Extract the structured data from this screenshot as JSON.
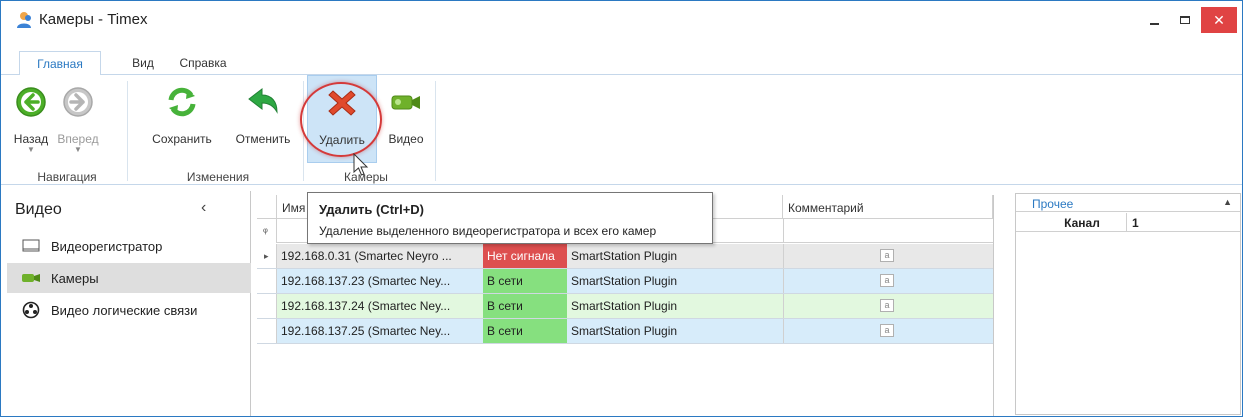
{
  "window": {
    "title": "Камеры - Timex",
    "close_glyph": "✕"
  },
  "tabs": [
    {
      "label": "Главная",
      "active": true
    },
    {
      "label": "Вид",
      "active": false
    },
    {
      "label": "Справка",
      "active": false
    }
  ],
  "ribbon": {
    "groups": [
      {
        "label": "Навигация"
      },
      {
        "label": "Изменения"
      },
      {
        "label": "Камеры"
      }
    ],
    "buttons": {
      "back": {
        "label": "Назад",
        "icon": "back-arrow-icon",
        "color": "#4caf28"
      },
      "forward": {
        "label": "Вперед",
        "icon": "forward-arrow-icon",
        "disabled": true
      },
      "save": {
        "label": "Сохранить",
        "icon": "refresh-icon",
        "color": "#47b23a"
      },
      "cancel": {
        "label": "Отменить",
        "icon": "undo-icon",
        "color": "#2ea843"
      },
      "delete": {
        "label": "Удалить",
        "icon": "delete-x-icon",
        "color": "#e04a2c"
      },
      "video": {
        "label": "Видео",
        "icon": "camera-icon",
        "color": "#6fb12b"
      }
    },
    "dropdown_glyph": "▼"
  },
  "tooltip": {
    "title": "Удалить (Ctrl+D)",
    "description": "Удаление выделенного видеорегистратора и всех его камер"
  },
  "nav": {
    "title": "Видео",
    "collapse_glyph": "‹",
    "items": [
      {
        "label": "Видеорегистратор",
        "icon": "dvr-icon",
        "active": false
      },
      {
        "label": "Камеры",
        "icon": "camera-icon",
        "active": true
      },
      {
        "label": "Видео логические связи",
        "icon": "link-icon",
        "active": false
      }
    ]
  },
  "grid": {
    "columns": [
      {
        "label": "Имя"
      },
      {
        "label": "Комментарий"
      }
    ],
    "filter_glyph": "ᵩ",
    "current_row_glyph": "▸",
    "comment_glyph": "a",
    "rows": [
      {
        "name": "192.168.0.31 (Smartec Neyro ...",
        "status": "Нет сигнала",
        "source": "SmartStation Plugin",
        "status_kind": "offline",
        "bg": "#e8e8e8"
      },
      {
        "name": "192.168.137.23 (Smartec Ney...",
        "status": "В сети",
        "source": "SmartStation Plugin",
        "status_kind": "online",
        "bg": "#d7ecfa"
      },
      {
        "name": "192.168.137.24 (Smartec Ney...",
        "status": "В сети",
        "source": "SmartStation Plugin",
        "status_kind": "online",
        "bg": "#e2f8df"
      },
      {
        "name": "192.168.137.25 (Smartec Ney...",
        "status": "В сети",
        "source": "SmartStation Plugin",
        "status_kind": "online",
        "bg": "#d7ecfa"
      }
    ],
    "status_colors": {
      "offline": "#dd4f4f",
      "online": "#86e07f"
    }
  },
  "properties": {
    "category": "Прочее",
    "collapse_glyph": "▲",
    "rows": [
      {
        "key": "Канал",
        "value": "1"
      }
    ]
  }
}
